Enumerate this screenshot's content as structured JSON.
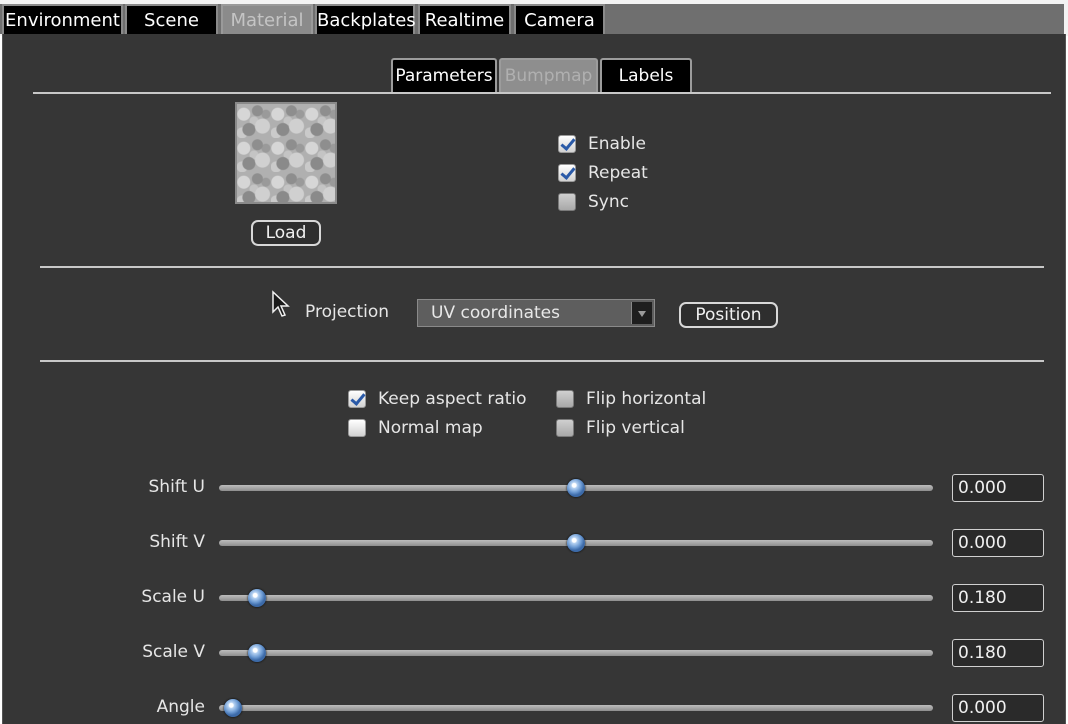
{
  "top_tabs": [
    {
      "label": "Environment",
      "active": false
    },
    {
      "label": "Scene",
      "active": false
    },
    {
      "label": "Material",
      "active": true
    },
    {
      "label": "Backplates",
      "active": false
    },
    {
      "label": "Realtime",
      "active": false
    },
    {
      "label": "Camera",
      "active": false
    }
  ],
  "sub_tabs": [
    {
      "label": "Parameters",
      "active": false
    },
    {
      "label": "Bumpmap",
      "active": true
    },
    {
      "label": "Labels",
      "active": false
    }
  ],
  "texture": {
    "load_label": "Load"
  },
  "options": [
    {
      "label": "Enable",
      "checked": true
    },
    {
      "label": "Repeat",
      "checked": true
    },
    {
      "label": "Sync",
      "checked": false
    }
  ],
  "projection": {
    "label": "Projection",
    "value": "UV coordinates",
    "position_label": "Position"
  },
  "flags": {
    "keep_aspect_ratio": {
      "label": "Keep aspect ratio",
      "checked": true
    },
    "normal_map": {
      "label": "Normal map",
      "checked": false
    },
    "flip_horizontal": {
      "label": "Flip horizontal",
      "checked": false
    },
    "flip_vertical": {
      "label": "Flip vertical",
      "checked": false
    }
  },
  "sliders": [
    {
      "label": "Shift U",
      "value": "0.000",
      "fraction": 0.5
    },
    {
      "label": "Shift V",
      "value": "0.000",
      "fraction": 0.5
    },
    {
      "label": "Scale U",
      "value": "0.180",
      "fraction": 0.053
    },
    {
      "label": "Scale V",
      "value": "0.180",
      "fraction": 0.053
    },
    {
      "label": "Angle",
      "value": "0.000",
      "fraction": 0.02
    }
  ],
  "colors": {
    "panel": "#363636",
    "tab_bg": "#000000",
    "active_tab": "#8b8b8b",
    "knob": "#6d9bd3"
  }
}
